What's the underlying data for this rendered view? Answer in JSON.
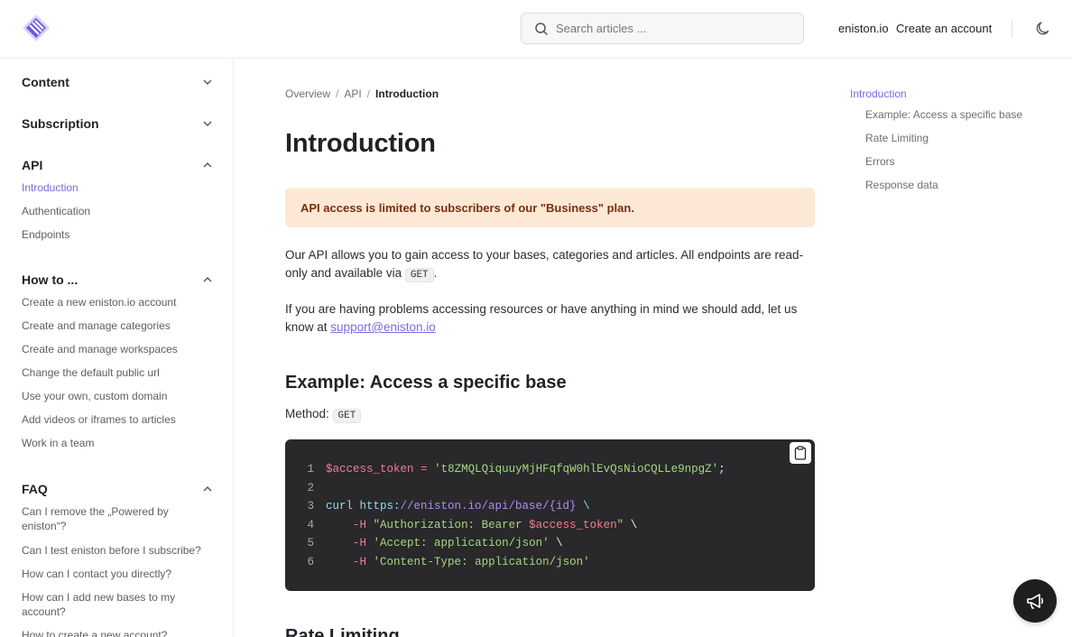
{
  "header": {
    "search_placeholder": "Search articles ...",
    "link_site": "eniston.io",
    "link_create": "Create an account"
  },
  "sidebar": {
    "sections": [
      {
        "title": "Content",
        "expanded": false,
        "items": []
      },
      {
        "title": "Subscription",
        "expanded": false,
        "items": []
      },
      {
        "title": "API",
        "expanded": true,
        "items": [
          "Introduction",
          "Authentication",
          "Endpoints"
        ]
      },
      {
        "title": "How to ...",
        "expanded": true,
        "items": [
          "Create a new eniston.io account",
          "Create and manage categories",
          "Create and manage workspaces",
          "Change the default public url",
          "Use your own, custom domain",
          "Add videos or iframes to articles",
          "Work in a team"
        ]
      },
      {
        "title": "FAQ",
        "expanded": true,
        "items": [
          "Can I remove the „Powered by eniston“?",
          "Can I test eniston before I subscribe?",
          "How can I contact you directly?",
          "How can I add new bases to my account?",
          "How to create a new account?"
        ]
      }
    ],
    "active_item": "Introduction"
  },
  "breadcrumb": [
    "Overview",
    "API",
    "Introduction"
  ],
  "main": {
    "title": "Introduction",
    "alert": "API access is limited to subscribers of our \"Business\" plan.",
    "para1_text": "Our API allows you to gain access to your bases, categories and articles. All endpoints are read-only and available via",
    "para1_code": "GET",
    "para1_end": ".",
    "para2_text": "If you are having problems accessing resources or have anything in mind we should add, let us know at",
    "para2_link": "support@eniston.io",
    "section1_title": "Example: Access a specific base",
    "method_label": "Method:",
    "method_value": "GET",
    "code_lines": [
      {
        "n": "1",
        "parts": [
          [
            "c-var",
            "$access_token"
          ],
          [
            "c-plain",
            " "
          ],
          [
            "c-op",
            "="
          ],
          [
            "c-plain",
            " "
          ],
          [
            "c-str",
            "'t8ZMQLQiquuyMjHFqfqW0hlEvQsNioCQLLe9npgZ'"
          ],
          [
            "c-plain",
            ";"
          ]
        ]
      },
      {
        "n": "2",
        "parts": []
      },
      {
        "n": "3",
        "parts": [
          [
            "c-cmd",
            "curl https:"
          ],
          [
            "c-url",
            "//eniston.io/api/base/{id}"
          ],
          [
            "c-plain",
            " "
          ],
          [
            "c-cmd",
            "\\"
          ]
        ]
      },
      {
        "n": "4",
        "parts": [
          [
            "c-plain",
            "    "
          ],
          [
            "c-flag",
            "-H"
          ],
          [
            "c-plain",
            " "
          ],
          [
            "c-str",
            "\"Authorization: Bearer "
          ],
          [
            "c-var",
            "$access_token"
          ],
          [
            "c-str",
            "\""
          ],
          [
            "c-plain",
            " \\"
          ]
        ]
      },
      {
        "n": "5",
        "parts": [
          [
            "c-plain",
            "    "
          ],
          [
            "c-flag",
            "-H"
          ],
          [
            "c-plain",
            " "
          ],
          [
            "c-str",
            "'Accept: application/json'"
          ],
          [
            "c-plain",
            " \\"
          ]
        ]
      },
      {
        "n": "6",
        "parts": [
          [
            "c-plain",
            "    "
          ],
          [
            "c-flag",
            "-H"
          ],
          [
            "c-plain",
            " "
          ],
          [
            "c-str",
            "'Content-Type: application/json'"
          ]
        ]
      }
    ],
    "section2_title": "Rate Limiting"
  },
  "toc": {
    "items": [
      "Introduction",
      "Example: Access a specific base",
      "Rate Limiting",
      "Errors",
      "Response data"
    ]
  },
  "colors": {
    "accent": "#7c6ae0",
    "alert_bg": "#fde8d6",
    "alert_text": "#7a2e10",
    "code_bg": "#29282a"
  },
  "icons": [
    "logo-icon",
    "search-icon",
    "moon-icon",
    "chevron-down-icon",
    "chevron-up-icon",
    "clipboard-icon",
    "megaphone-icon"
  ]
}
